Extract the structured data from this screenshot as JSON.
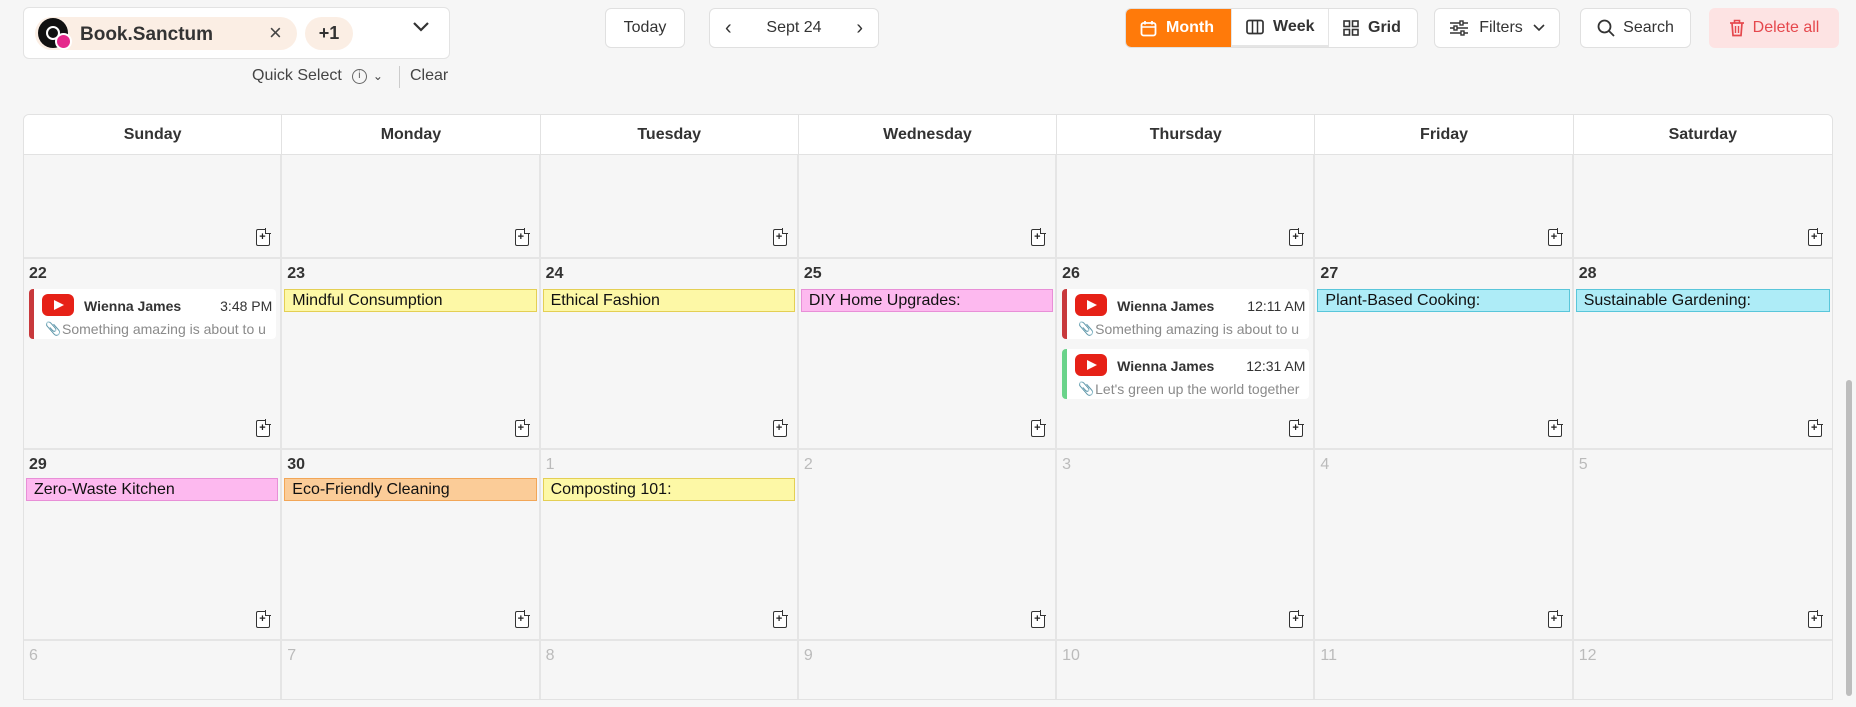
{
  "account": {
    "name": "Book.Sanctum",
    "extra_count": "+1",
    "remove_label": "×",
    "avatar_icon": "threads-icon",
    "badge_icon": "instagram-icon",
    "dropdown_icon": "chevron-down-icon"
  },
  "quick_select": {
    "label": "Quick Select",
    "info_glyph": "i",
    "caret": "⌄",
    "clear_label": "Clear"
  },
  "toolbar": {
    "today_label": "Today",
    "prev_glyph": "‹",
    "next_glyph": "›",
    "period_label": "Sept 24",
    "views": {
      "month": "Month",
      "week": "Week",
      "grid": "Grid"
    },
    "active_view": "Month",
    "filters_label": "Filters",
    "search_label": "Search",
    "delete_all_label": "Delete all"
  },
  "colors": {
    "accent": "#ff7a0a",
    "danger": "#e5484d",
    "youtube": "#e62117"
  },
  "calendar": {
    "weekdays": [
      "Sunday",
      "Monday",
      "Tuesday",
      "Wednesday",
      "Thursday",
      "Friday",
      "Saturday"
    ],
    "add_note_glyph": "+",
    "weeks": [
      [
        "",
        "",
        "",
        "",
        "",
        "",
        ""
      ],
      [
        "22",
        "23",
        "24",
        "25",
        "26",
        "27",
        "28"
      ],
      [
        "29",
        "30",
        "1",
        "2",
        "3",
        "4",
        "5"
      ],
      [
        "6",
        "7",
        "8",
        "9",
        "10",
        "11",
        "12"
      ]
    ],
    "tags": {
      "mon23": "Mindful Consumption",
      "tue24": "Ethical Fashion",
      "wed25": "DIY Home Upgrades:",
      "fri27": "Plant-Based Cooking:",
      "sat28": "Sustainable Gardening:",
      "sun29": "Zero-Waste Kitchen",
      "mon30": "Eco-Friendly Cleaning",
      "tue1": "Composting 101:"
    },
    "posts": {
      "sun22": {
        "author": "Wienna James",
        "time": "3:48 PM",
        "text": "Something amazing is about to u"
      },
      "thu26a": {
        "author": "Wienna James",
        "time": "12:11 AM",
        "text": "Something amazing is about to u"
      },
      "thu26b": {
        "author": "Wienna James",
        "time": "12:31 AM",
        "text": "Let's green up the world together"
      }
    }
  }
}
